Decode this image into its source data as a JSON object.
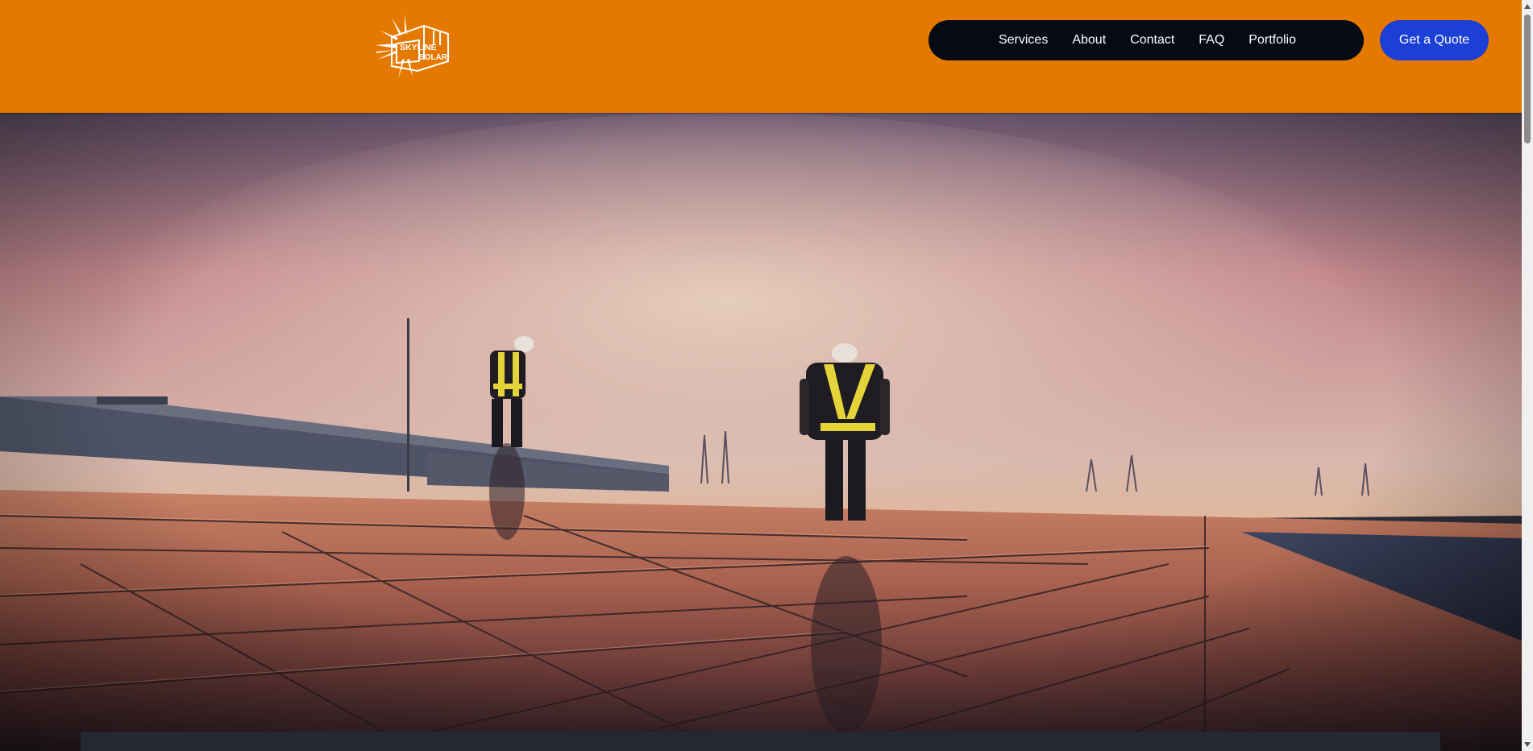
{
  "brand": {
    "logo_line1": "SKYLINE",
    "logo_line2": "SOLAR",
    "header_color": "#e57900"
  },
  "nav": {
    "items": [
      {
        "label": "Services"
      },
      {
        "label": "About"
      },
      {
        "label": "Contact"
      },
      {
        "label": "FAQ"
      },
      {
        "label": "Portfolio"
      }
    ]
  },
  "cta": {
    "label": "Get a Quote",
    "color": "#1c3fd6"
  },
  "hero": {
    "image_icon": "solar-rooftop-workers-photo"
  }
}
